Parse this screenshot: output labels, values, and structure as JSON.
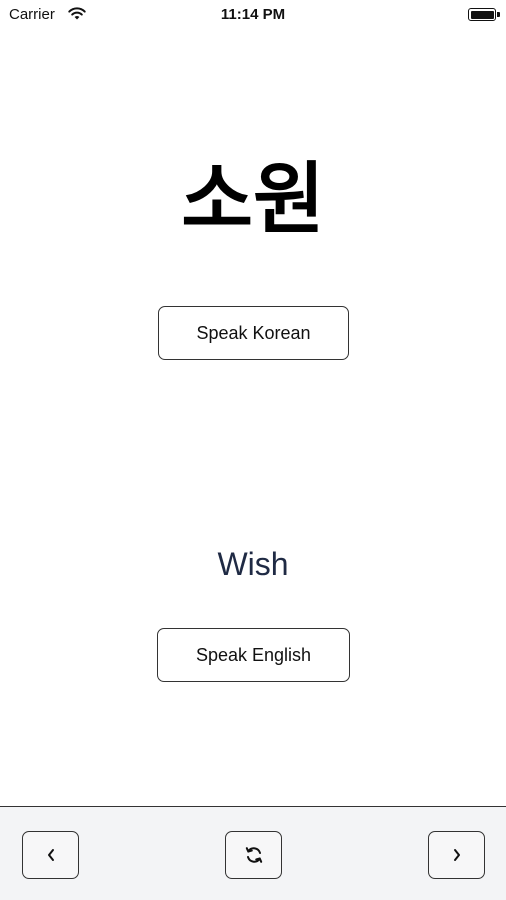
{
  "status_bar": {
    "carrier": "Carrier",
    "time": "11:14 PM"
  },
  "flashcard": {
    "korean_word": "소원",
    "speak_korean_label": "Speak Korean",
    "english_word": "Wish",
    "speak_english_label": "Speak English"
  },
  "toolbar": {
    "buttons": [
      {
        "name": "previous",
        "icon": "chevron-left-icon"
      },
      {
        "name": "refresh",
        "icon": "refresh-icon"
      },
      {
        "name": "next",
        "icon": "chevron-right-icon"
      }
    ]
  },
  "colors": {
    "background": "#ffffff",
    "toolbar_background": "#f3f4f6",
    "english_word": "#1f2a44",
    "border": "#333333"
  }
}
